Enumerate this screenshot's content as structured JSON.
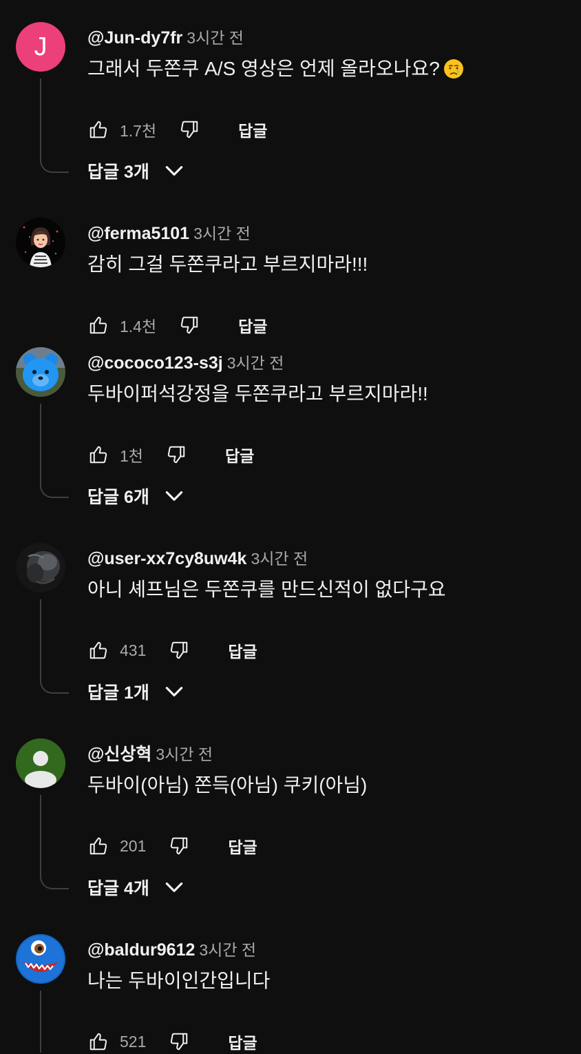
{
  "comments": [
    {
      "author": "@Jun-dy7fr",
      "time": "3시간 전",
      "text": "그래서 두쫀쿠 A/S 영상은 언제 올라오나요?",
      "emoji": "crying-face-icon",
      "likes": "1.7천",
      "reply_label": "답글",
      "replies_label": "답글 3개",
      "avatar": {
        "type": "letter",
        "letter": "J",
        "color": "#ec407a"
      }
    },
    {
      "author": "@ferma5101",
      "time": "3시간 전",
      "text": "감히 그걸 두쫀쿠라고 부르지마라!!!",
      "likes": "1.4천",
      "reply_label": "답글",
      "avatar": {
        "type": "image",
        "icon": "girl-avatar-icon"
      }
    },
    {
      "author": "@cococo123-s3j",
      "time": "3시간 전",
      "text": "두바이퍼석강정을 두쫀쿠라고 부르지마라!!",
      "likes": "1천",
      "reply_label": "답글",
      "replies_label": "답글 6개",
      "avatar": {
        "type": "image",
        "icon": "blue-bear-avatar-icon"
      }
    },
    {
      "author": "@user-xx7cy8uw4k",
      "time": "3시간 전",
      "text": "아니 셰프님은 두쫀쿠를 만드신적이 없다구요",
      "likes": "431",
      "reply_label": "답글",
      "replies_label": "답글 1개",
      "avatar": {
        "type": "image",
        "icon": "dark-photo-avatar-icon"
      }
    },
    {
      "author": "@신상혁",
      "time": "3시간 전",
      "text": "두바이(아님) 쫀득(아님) 쿠키(아님)",
      "likes": "201",
      "reply_label": "답글",
      "replies_label": "답글 4개",
      "avatar": {
        "type": "default",
        "color": "#33691e"
      }
    },
    {
      "author": "@baldur9612",
      "time": "3시간 전",
      "text": "나는 두바이인간입니다",
      "likes": "521",
      "reply_label": "답글",
      "avatar": {
        "type": "image",
        "icon": "blue-monster-avatar-icon"
      }
    }
  ],
  "colors": {
    "background": "#0f0f0f",
    "text_primary": "#f1f1f1",
    "text_secondary": "#aaaaaa",
    "thread_line": "#3f3f3f"
  }
}
